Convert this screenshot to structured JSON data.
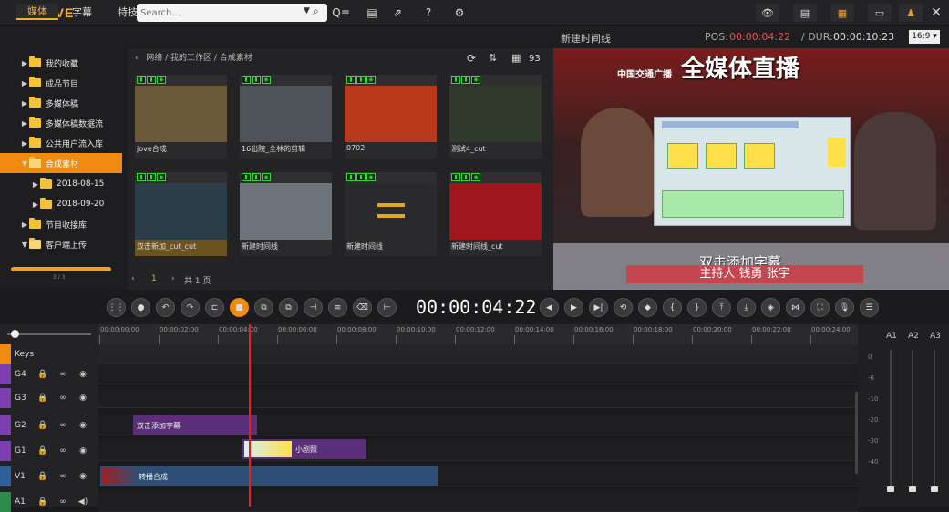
{
  "app": {
    "logo": "JOVE"
  },
  "search": {
    "placeholder": "Search..."
  },
  "left_tabs": [
    "媒体",
    "字幕",
    "特技"
  ],
  "tree": [
    {
      "label": "我的收藏",
      "expanded": false,
      "indent": 0
    },
    {
      "label": "成品节目",
      "expanded": false,
      "indent": 0
    },
    {
      "label": "多媒体稿",
      "expanded": false,
      "indent": 0
    },
    {
      "label": "多媒体稿数据流",
      "expanded": false,
      "indent": 0
    },
    {
      "label": "公共用户流入库",
      "expanded": false,
      "indent": 0
    },
    {
      "label": "合成素材",
      "expanded": true,
      "indent": 0,
      "selected": true
    },
    {
      "label": "2018-08-15",
      "expanded": false,
      "indent": 1
    },
    {
      "label": "2018-09-20",
      "expanded": false,
      "indent": 1
    },
    {
      "label": "节目收接库",
      "expanded": false,
      "indent": 0
    },
    {
      "label": "客户端上传",
      "expanded": true,
      "indent": 0
    }
  ],
  "left_scroll_label": "3 / 3",
  "breadcrumb": {
    "parts": [
      "网络",
      "我的工作区",
      "合成素材"
    ],
    "count": "93"
  },
  "thumbnails": [
    {
      "label": "jove合成",
      "color": "#6a5a3a"
    },
    {
      "label": "16出院_全林的剪辑",
      "color": "#4d5358"
    },
    {
      "label": "0702",
      "color": "#b8391c"
    },
    {
      "label": "测试4_cut",
      "color": "#2f3a2c"
    },
    {
      "label": "双击新加_cut_cut",
      "color": "#2c3d4a",
      "selected": true
    },
    {
      "label": "新建时间线",
      "color": "#6d747c"
    },
    {
      "label": "新建时间线",
      "color": "#2a2a2c",
      "placeholder": true
    },
    {
      "label": "新建时间线_cut",
      "color": "#a0161c"
    }
  ],
  "pager": {
    "page": "1",
    "total": "共 1 页"
  },
  "preview": {
    "title": "新建时间线",
    "pos_label": "POS:",
    "pos": "00:00:04:22",
    "dur_label": "/ DUR:",
    "dur": "00:00:10:23",
    "ratio": "16:9 ▾",
    "banner_top": "中国交通广播",
    "banner_big": "全媒体直播",
    "subtitle": "双击添加字幕",
    "caption": "主持人 钱勇 张宇"
  },
  "transport": {
    "timecode": "00:00:04:22"
  },
  "ruler_ticks": [
    "00:00:00:00",
    "00:00:02:00",
    "00:00:04:00",
    "00:00:06:00",
    "00:00:08:00",
    "00:00:10:00",
    "00:00:12:00",
    "00:00:14:00",
    "00:00:16:00",
    "00:00:18:00",
    "00:00:20:00",
    "00:00:22:00",
    "00:00:24:00"
  ],
  "tracks": [
    {
      "name": "Keys",
      "color": "#f08a10"
    },
    {
      "name": "G4",
      "color": "#7b3fb0"
    },
    {
      "name": "G3",
      "color": "#7b3fb0"
    },
    {
      "name": "G2",
      "color": "#7b3fb0"
    },
    {
      "name": "G1",
      "color": "#7b3fb0"
    },
    {
      "name": "V1",
      "color": "#2e5f9a"
    },
    {
      "name": "A1",
      "color": "#2e8a4a"
    }
  ],
  "clips": {
    "g2": "双击添加字幕",
    "g1": "小剧照",
    "v1": "转播合成"
  },
  "mixer": {
    "channels": [
      "A1",
      "A2",
      "A3"
    ],
    "scale": [
      "0",
      "-6",
      "-10",
      "-20",
      "-30",
      "-40"
    ]
  }
}
